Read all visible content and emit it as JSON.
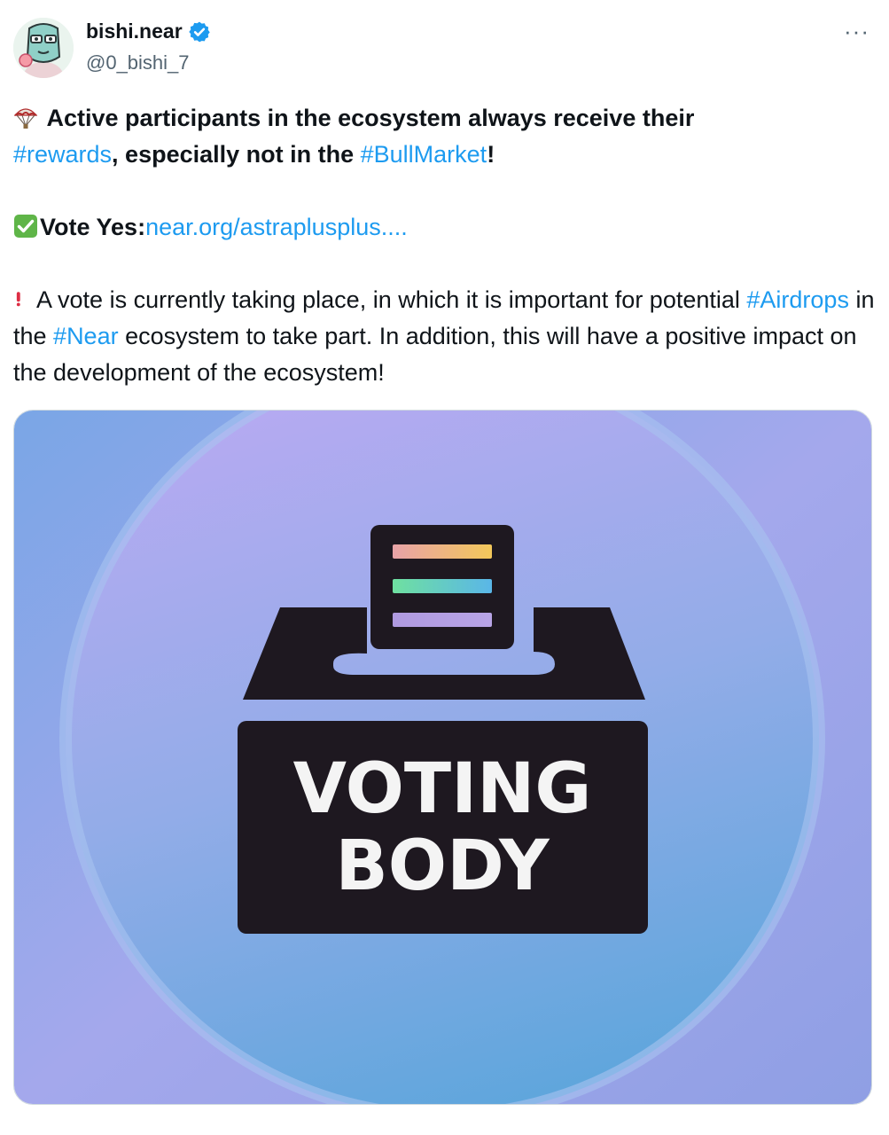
{
  "author": {
    "display_name": "bishi.near",
    "handle": "@0_bishi_7",
    "verified": true,
    "avatar_icon": "cartoon-avatar-icon"
  },
  "menu": {
    "more_label": "···"
  },
  "tweet": {
    "line1_bold": "Active participants in the ecosystem always receive their",
    "hashtag_rewards": "#rewards",
    "line2_bold": ", especially not in the ",
    "hashtag_bullmarket": "#BullMarket",
    "line2_end": "!",
    "vote_label": "Vote Yes:",
    "vote_link": "near.org/astraplusplus....",
    "para3_start": " A vote is currently taking place, in which it is important for potential ",
    "hashtag_airdrops": "#Airdrops",
    "para3_mid": " in the ",
    "hashtag_near": "#Near",
    "para3_end": " ecosystem to take part. In addition, this will have a positive impact on the development of the ecosystem!"
  },
  "media": {
    "line1": "VOTING",
    "line2": "BODY"
  },
  "colors": {
    "link": "#1d9bf0",
    "text": "#0f1419",
    "muted": "#536471",
    "verified": "#1d9bf0",
    "box": "#1e1820"
  }
}
